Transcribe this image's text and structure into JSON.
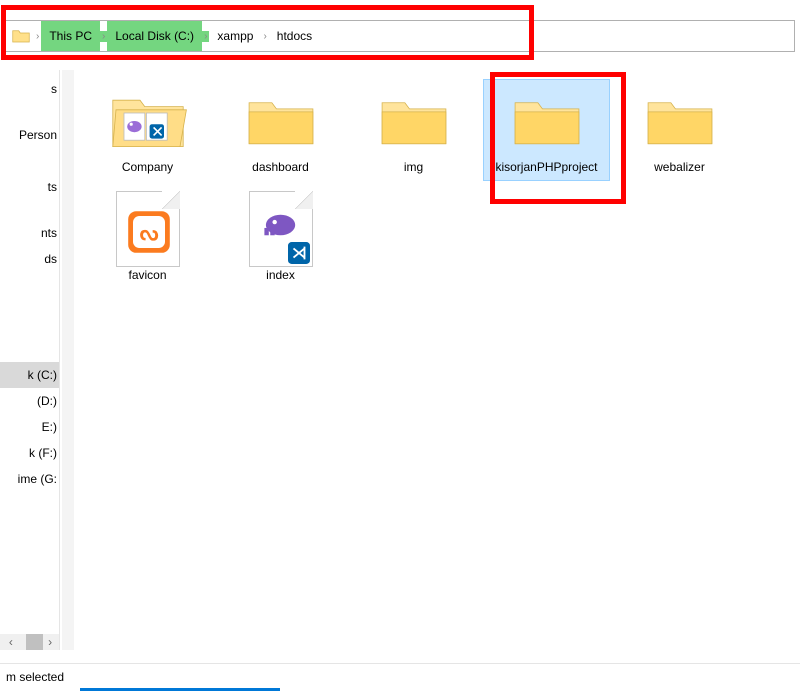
{
  "breadcrumb": {
    "items": [
      "This PC",
      "Local Disk (C:)",
      "xampp",
      "htdocs"
    ],
    "highlighted": [
      true,
      true,
      false,
      false
    ]
  },
  "sidebar": {
    "items": [
      {
        "label": "s"
      },
      {
        "label": "Person"
      },
      {
        "label": ""
      },
      {
        "label": "ts"
      },
      {
        "label": ""
      },
      {
        "label": "nts"
      },
      {
        "label": "ds"
      },
      {
        "label": ""
      },
      {
        "label": ""
      },
      {
        "label": ""
      },
      {
        "label": "k (C:)",
        "selected": true
      },
      {
        "label": "(D:)"
      },
      {
        "label": "E:)"
      },
      {
        "label": "k (F:)"
      },
      {
        "label": "ime (G:"
      }
    ]
  },
  "content": {
    "items": [
      {
        "name": "Company",
        "type": "folder-open-apps",
        "selected": false
      },
      {
        "name": "dashboard",
        "type": "folder",
        "selected": false
      },
      {
        "name": "img",
        "type": "folder",
        "selected": false
      },
      {
        "name": "kisorjanPHPproject",
        "type": "folder",
        "selected": true
      },
      {
        "name": "webalizer",
        "type": "folder",
        "selected": false
      },
      {
        "name": "favicon",
        "type": "file-xampp",
        "selected": false
      },
      {
        "name": "index",
        "type": "file-php-vscode",
        "selected": false
      }
    ]
  },
  "status": {
    "text": "m selected"
  },
  "highlights": {
    "breadcrumb_box": true,
    "selected_item_box": true
  }
}
